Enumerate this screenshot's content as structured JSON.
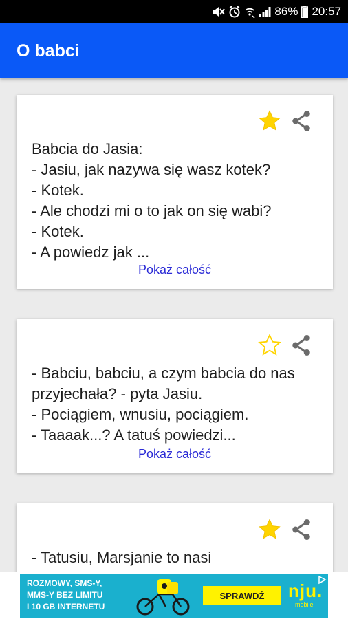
{
  "status_bar": {
    "battery": "86%",
    "time": "20:57"
  },
  "app_bar": {
    "title": "O babci"
  },
  "cards": [
    {
      "favorited": true,
      "text": "Babcia do Jasia:\n- Jasiu, jak nazywa się wasz kotek?\n- Kotek.\n- Ale chodzi mi o to jak on się wabi?\n- Kotek.\n- A powiedz jak ...",
      "more_label": "Pokaż całość"
    },
    {
      "favorited": false,
      "text": "- Babciu, babciu, a czym babcia do nas przyjechała? - pyta Jasiu.\n- Pociągiem, wnusiu, pociągiem.\n- Taaaak...? A tatuś powiedzi...",
      "more_label": "Pokaż całość"
    },
    {
      "favorited": true,
      "text": "- Tatusiu, Marsjanie to nasi"
    }
  ],
  "ad": {
    "text": "ROZMOWY, SMS-Y,\nMMS-Y BEZ LIMITU\nI 10 GB INTERNETU",
    "cta": "SPRAWDŹ",
    "logo": "nju.",
    "logo_sub": "mobile"
  },
  "colors": {
    "app_bar": "#0a59f7",
    "star_filled": "#ffd400",
    "link": "#2b2bd6",
    "ad_bg": "#1ab0ce"
  }
}
